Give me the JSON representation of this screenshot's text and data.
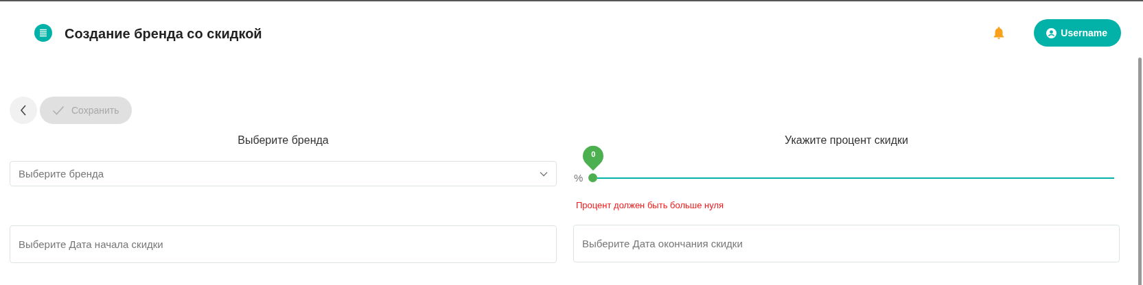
{
  "header": {
    "title": "Создание бренда со скидкой",
    "user_button": "Username"
  },
  "toolbar": {
    "save_button": {
      "label": "Сохранить",
      "disabled": true
    }
  },
  "brand": {
    "label": "Выберите бренда",
    "placeholder": "Выберите бренда"
  },
  "discount": {
    "label": "Укажите процент скидки",
    "unit": "%",
    "value": "0",
    "level": 0,
    "error": "Процент должен быть больше нуля"
  },
  "start_date": {
    "placeholder": "Выберите Дата начала скидки"
  },
  "end_date": {
    "placeholder": "Выберите Дата окончания скидки"
  }
}
